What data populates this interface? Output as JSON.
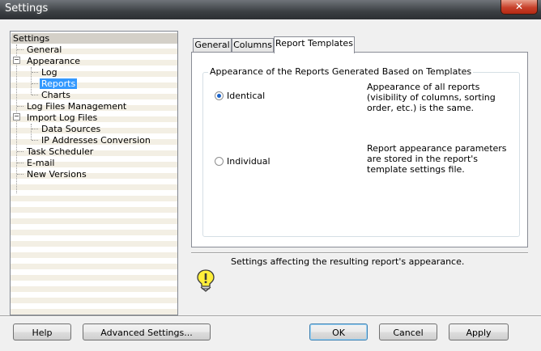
{
  "window": {
    "title": "Settings",
    "close_glyph": "✕"
  },
  "tree": {
    "root": "Settings",
    "items": [
      {
        "label": "General",
        "level": 1
      },
      {
        "label": "Appearance",
        "level": 1,
        "expander": "−"
      },
      {
        "label": "Log",
        "level": 2
      },
      {
        "label": "Reports",
        "level": 2,
        "selected": true
      },
      {
        "label": "Charts",
        "level": 2
      },
      {
        "label": "Log Files Management",
        "level": 1
      },
      {
        "label": "Import Log Files",
        "level": 1,
        "expander": "−"
      },
      {
        "label": "Data Sources",
        "level": 2
      },
      {
        "label": "IP Addresses Conversion",
        "level": 2
      },
      {
        "label": "Task Scheduler",
        "level": 1
      },
      {
        "label": "E-mail",
        "level": 1
      },
      {
        "label": "New Versions",
        "level": 1
      }
    ]
  },
  "tabs": [
    {
      "label": "General"
    },
    {
      "label": "Columns"
    },
    {
      "label": "Report Templates",
      "active": true
    }
  ],
  "group": {
    "title": "Appearance of the Reports Generated Based on Templates",
    "options": [
      {
        "label": "Identical",
        "checked": true,
        "description": "Appearance of all reports (visibility of columns, sorting order, etc.) is the same."
      },
      {
        "label": "Individual",
        "checked": false,
        "description": "Report appearance parameters are stored in the report's template settings file."
      }
    ]
  },
  "info": {
    "icon": "lightbulb-icon",
    "text": "Settings affecting the resulting report's appearance."
  },
  "buttons": {
    "help": "Help",
    "advanced": "Advanced Settings...",
    "ok": "OK",
    "cancel": "Cancel",
    "apply": "Apply"
  }
}
